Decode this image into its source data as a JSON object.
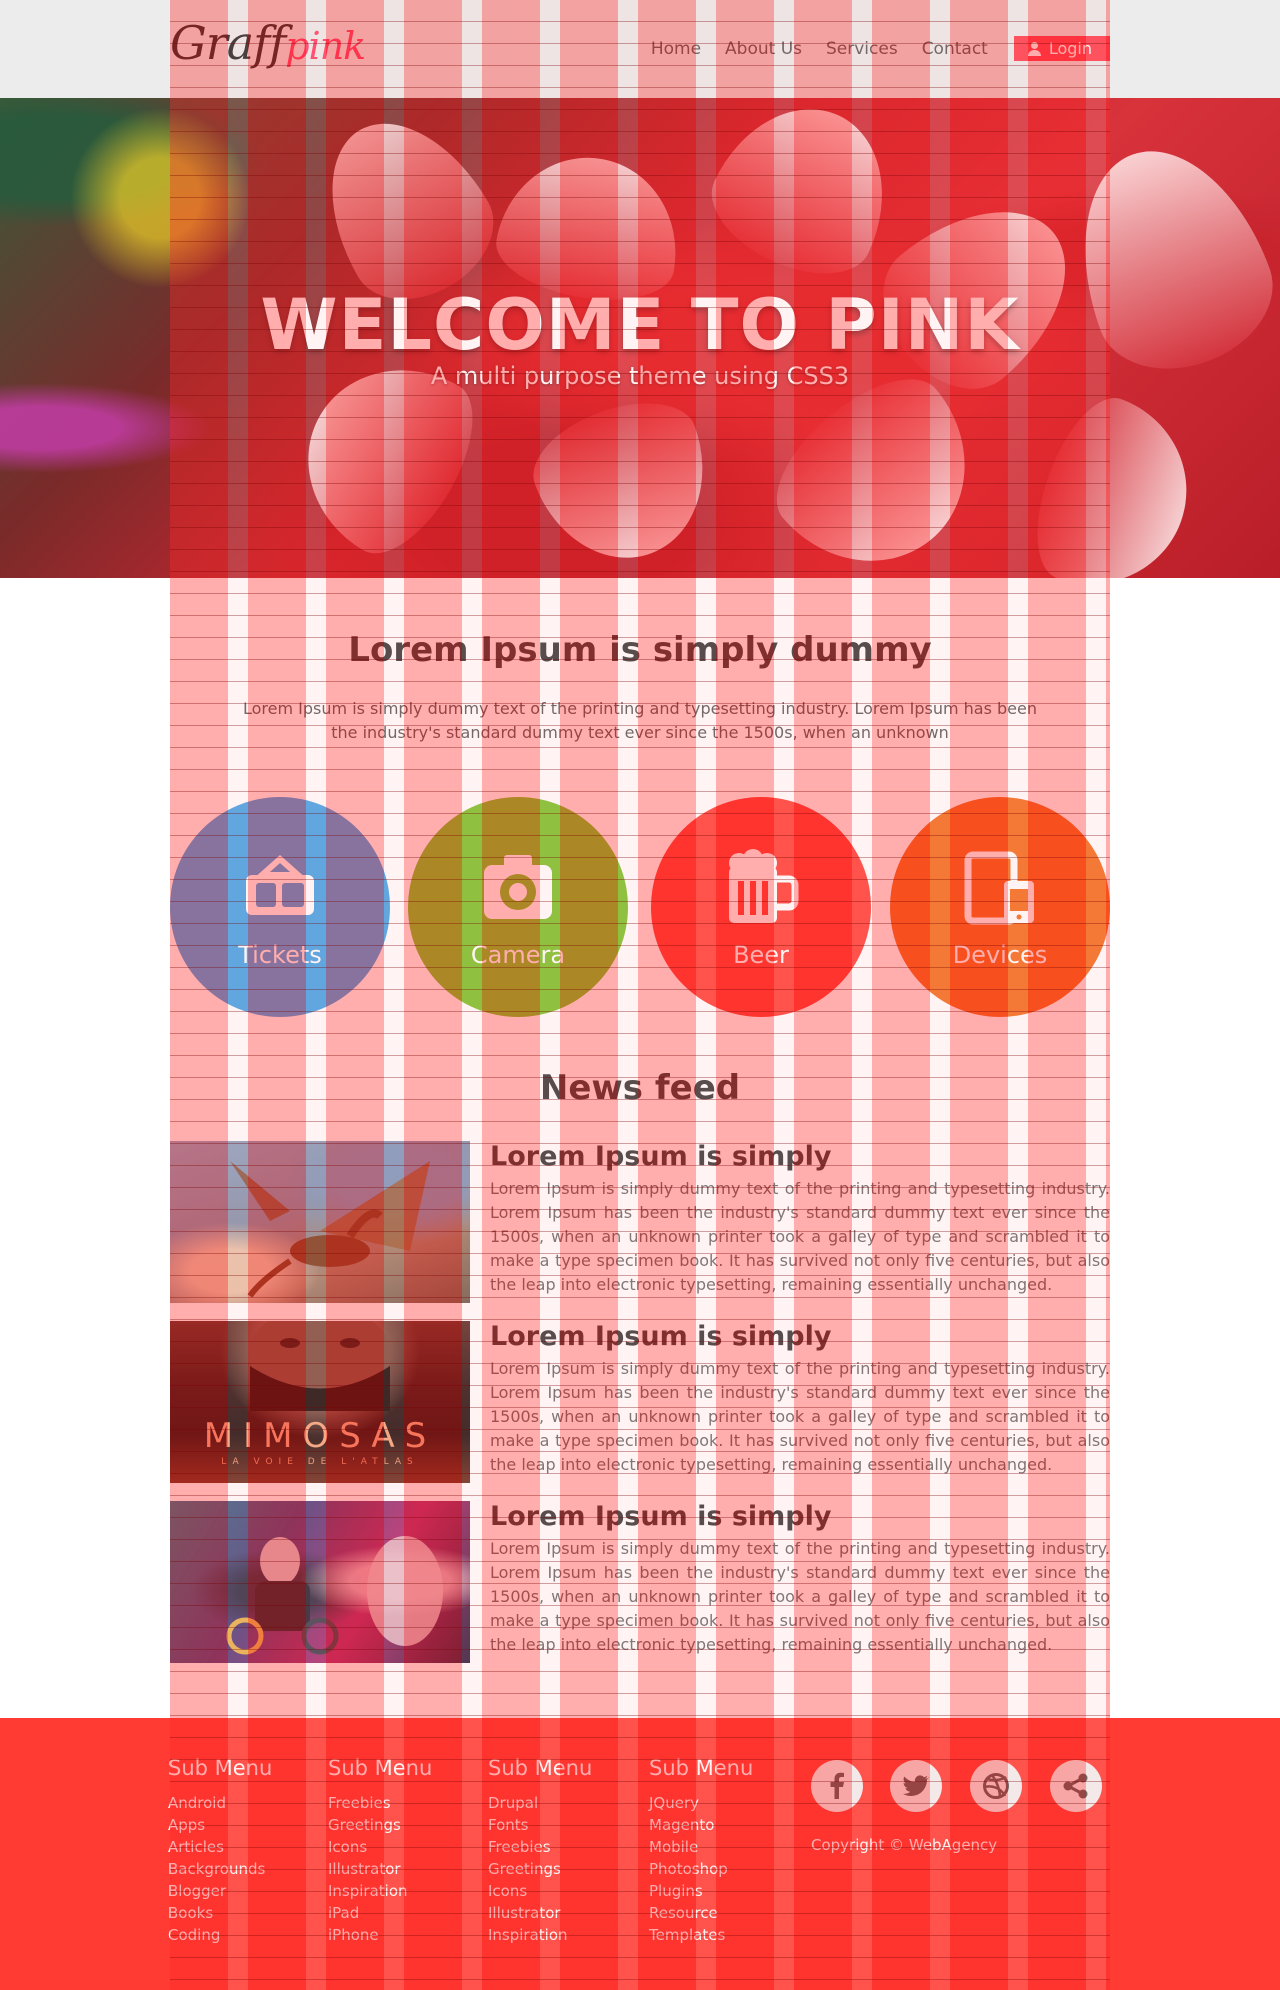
{
  "header": {
    "logo_part1": "Graff",
    "logo_part2": "pink",
    "nav": [
      "Home",
      "About Us",
      "Services",
      "Contact"
    ],
    "login_label": "Login"
  },
  "hero": {
    "title": "WELCOME TO PINK",
    "subtitle": "A multi purpose theme using CSS3"
  },
  "intro": {
    "title": "Lorem Ipsum is simply dummy",
    "text": "Lorem Ipsum is simply dummy text of the printing and typesetting industry. Lorem Ipsum has been the industry's standard dummy text ever since the 1500s, when an unknown"
  },
  "features": [
    {
      "label": "Tickets",
      "icon": "ticket-icon",
      "color": "#3fa1e6"
    },
    {
      "label": "Camera",
      "icon": "camera-icon",
      "color": "#77c123"
    },
    {
      "label": "Beer",
      "icon": "beer-mug-icon",
      "color": "#ff3b33"
    },
    {
      "label": "Devices",
      "icon": "devices-icon",
      "color": "#f26818"
    }
  ],
  "news": {
    "title": "News feed",
    "items": [
      {
        "heading": "Lorem Ipsum is simply",
        "body": "Lorem Ipsum is simply dummy text of the printing and typesetting industry. Lorem Ipsum has been the industry's standard dummy text ever since the 1500s, when an unknown printer took a galley of type and scrambled it to make a type specimen book. It has survived not only five centuries, but also the leap into electronic typesetting, remaining essentially unchanged."
      },
      {
        "heading": "Lorem Ipsum is simply",
        "body": "Lorem Ipsum is simply dummy text of the printing and typesetting industry. Lorem Ipsum has been the industry's standard dummy text ever since the 1500s, when an unknown printer took a galley of type and scrambled it to make a type specimen book. It has survived not only five centuries, but also the leap into electronic typesetting, remaining essentially unchanged.",
        "poster_title": "MIMOSAS",
        "poster_subtitle": "LA VOIE DE L'ATLAS"
      },
      {
        "heading": "Lorem Ipsum is simply",
        "body": "Lorem Ipsum is simply dummy text of the printing and typesetting industry. Lorem Ipsum has been the industry's standard dummy text ever since the 1500s, when an unknown printer took a galley of type and scrambled it to make a type specimen book. It has survived not only five centuries, but also the leap into electronic typesetting, remaining essentially unchanged."
      }
    ]
  },
  "footer": {
    "columns": [
      {
        "title": "Sub Menu",
        "items": [
          "Android",
          "Apps",
          "Articles",
          "Backgrounds",
          "Blogger",
          "Books",
          "Coding"
        ]
      },
      {
        "title": "Sub Menu",
        "items": [
          "Freebies",
          "Greetings",
          "Icons",
          "Illustrator",
          "Inspiration",
          "iPad",
          "iPhone"
        ]
      },
      {
        "title": "Sub Menu",
        "items": [
          "Drupal",
          "Fonts",
          "Freebies",
          "Greetings",
          "Icons",
          "Illustrator",
          "Inspiration"
        ]
      },
      {
        "title": "Sub Menu",
        "items": [
          "JQuery",
          "Magento",
          "Mobile",
          "Photoshop",
          "Plugins",
          "Resource",
          "Templates"
        ]
      }
    ],
    "social": [
      "facebook-icon",
      "twitter-icon",
      "dribbble-icon",
      "share-icon"
    ],
    "copyright": "Copyright © WebAgency"
  },
  "colors": {
    "accent": "#ff3a4a",
    "footer_bg": "#ff3b33",
    "header_bg": "#ececec"
  }
}
